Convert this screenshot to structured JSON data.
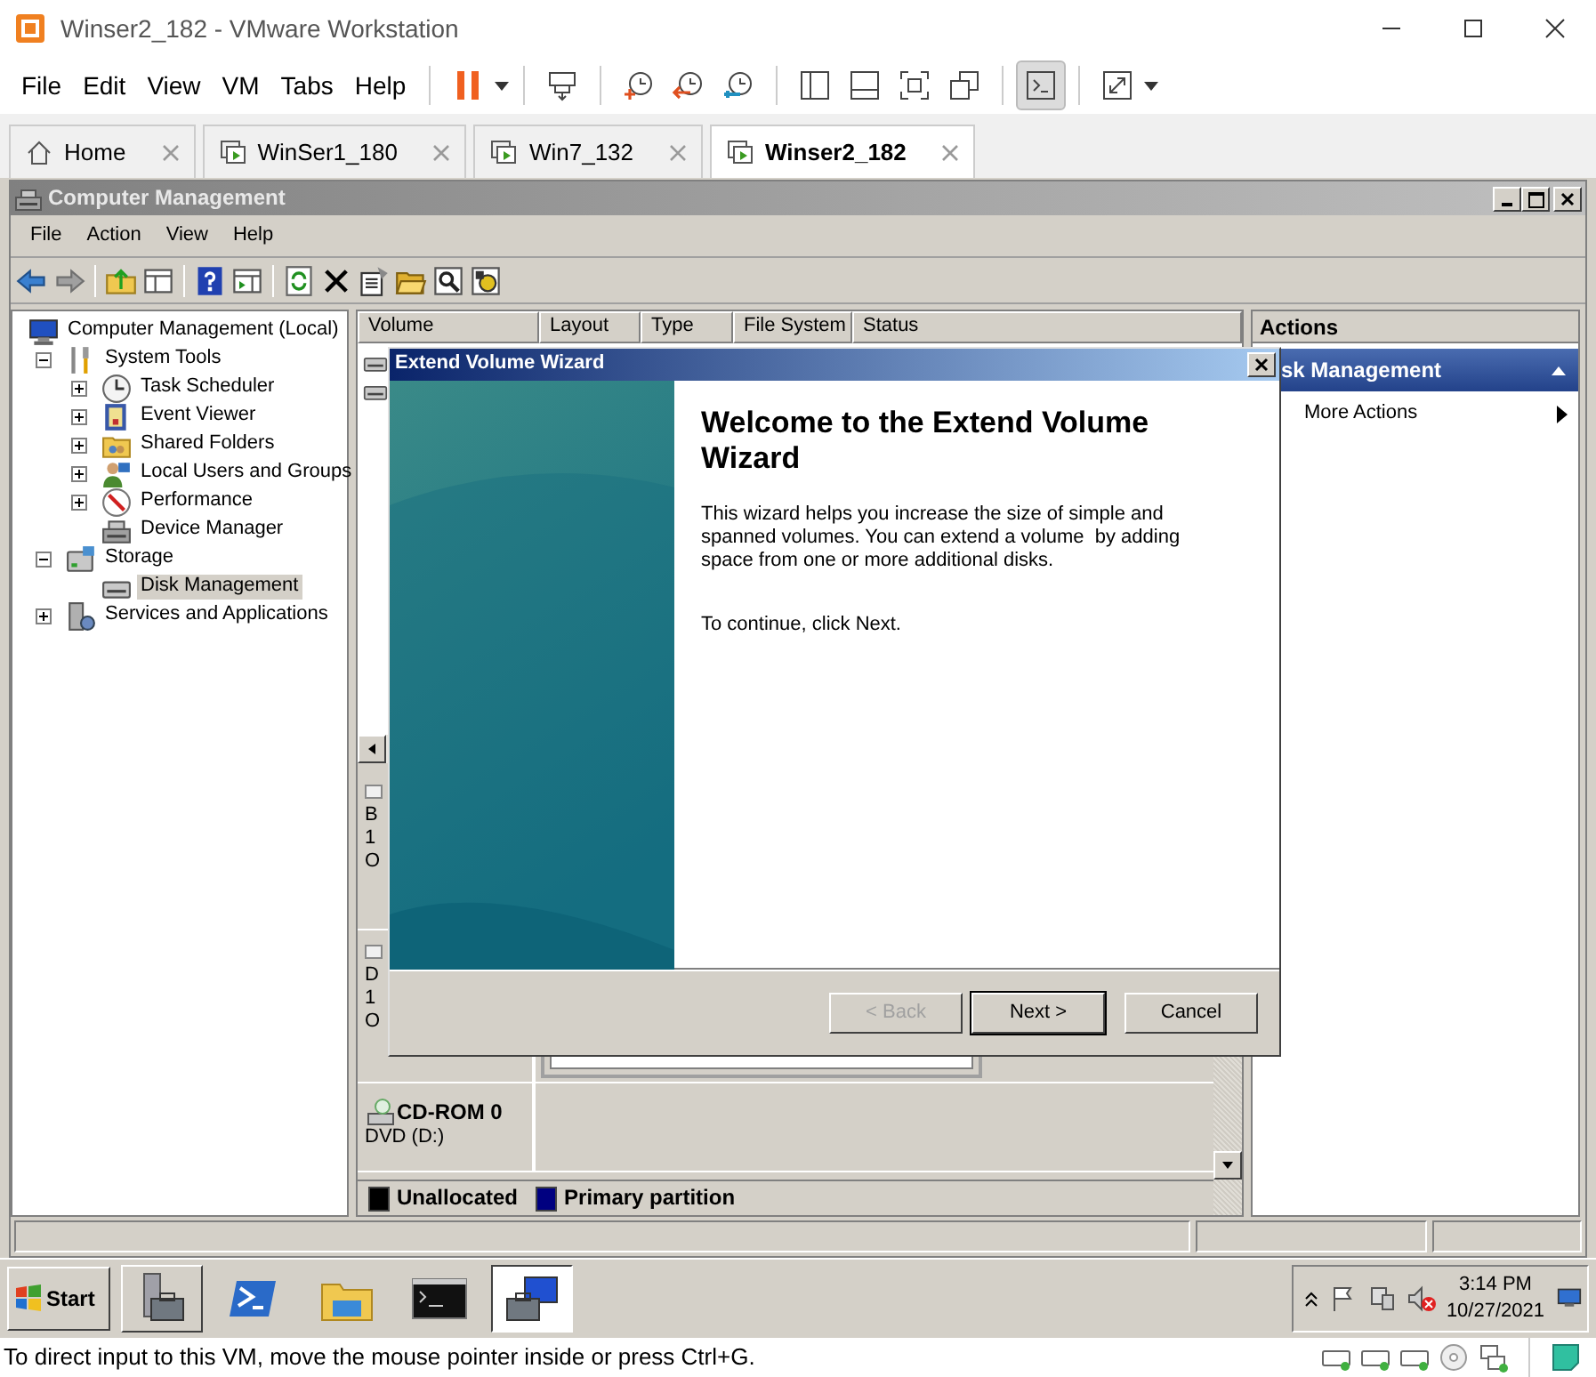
{
  "app_window": {
    "title": "Winser2_182 - VMware Workstation"
  },
  "menu": [
    "File",
    "Edit",
    "View",
    "VM",
    "Tabs",
    "Help"
  ],
  "console_view_active": true,
  "vm_tabs": [
    {
      "label": "Home",
      "kind": "home",
      "selected": false
    },
    {
      "label": "WinSer1_180",
      "kind": "vm",
      "selected": false
    },
    {
      "label": "Win7_132",
      "kind": "vm",
      "selected": false
    },
    {
      "label": "Winser2_182",
      "kind": "vm",
      "selected": true
    }
  ],
  "guest": {
    "window": {
      "title": "Computer Management",
      "menu": [
        "File",
        "Action",
        "View",
        "Help"
      ]
    },
    "tree": [
      {
        "label": "Computer Management (Local)",
        "kind": "computer",
        "selected": false,
        "children": [
          {
            "label": "System Tools",
            "kind": "tools",
            "expanded": true,
            "selected": false,
            "children": [
              {
                "label": "Task Scheduler",
                "kind": "clock",
                "expanded": false,
                "selected": false
              },
              {
                "label": "Event Viewer",
                "kind": "event",
                "expanded": false,
                "selected": false
              },
              {
                "label": "Shared Folders",
                "kind": "folder",
                "expanded": false,
                "selected": false
              },
              {
                "label": "Local Users and Groups",
                "kind": "users",
                "expanded": false,
                "selected": false
              },
              {
                "label": "Performance",
                "kind": "performance",
                "expanded": false,
                "selected": false
              },
              {
                "label": "Device Manager",
                "kind": "device",
                "selected": false
              }
            ]
          },
          {
            "label": "Storage",
            "kind": "storage",
            "expanded": true,
            "selected": false,
            "children": [
              {
                "label": "Disk Management",
                "kind": "disk",
                "selected": true
              }
            ]
          },
          {
            "label": "Services and Applications",
            "kind": "services",
            "expanded": false,
            "selected": false
          }
        ]
      }
    ],
    "columns": [
      "Volume",
      "Layout",
      "Type",
      "File System",
      "Status"
    ],
    "disks": [
      {
        "kind": "disk",
        "lines": [
          "B",
          "1",
          "O"
        ]
      },
      {
        "kind": "disk",
        "lines": [
          "D",
          "1",
          "O"
        ]
      },
      {
        "kind": "cdrom",
        "title": "CD-ROM 0",
        "lines": [
          "DVD (D:)"
        ]
      }
    ],
    "legend": [
      {
        "label": "Unallocated",
        "color": "#000000"
      },
      {
        "label": "Primary partition",
        "color": "#000080"
      }
    ],
    "actions": {
      "title": "Actions",
      "section": "sk Management",
      "items": [
        "More Actions"
      ]
    },
    "wizard": {
      "title": "Extend Volume Wizard",
      "heading": "Welcome to the Extend Volume Wizard",
      "paragraphs": [
        "This wizard helps you increase the size of simple and spanned volumes. You can extend a volume  by adding space from one or more additional disks.",
        "To continue, click Next."
      ],
      "buttons": [
        {
          "label": "< Back",
          "disabled": true,
          "default": false
        },
        {
          "label": "Next >",
          "disabled": false,
          "default": true
        },
        {
          "label": "Cancel",
          "disabled": false,
          "default": false
        }
      ]
    },
    "taskbar": {
      "start": "Start",
      "apps": [
        {
          "kind": "server-manager",
          "running": true,
          "selected": false
        },
        {
          "kind": "powershell",
          "running": false,
          "selected": false
        },
        {
          "kind": "explorer",
          "running": false,
          "selected": false
        },
        {
          "kind": "cmd",
          "running": false,
          "selected": false
        },
        {
          "kind": "computer-management",
          "running": true,
          "selected": true
        }
      ],
      "time": "3:14 PM",
      "date": "10/27/2021"
    }
  },
  "status_bar": {
    "text": "To direct input to this VM, move the mouse pointer inside or press Ctrl+G."
  }
}
